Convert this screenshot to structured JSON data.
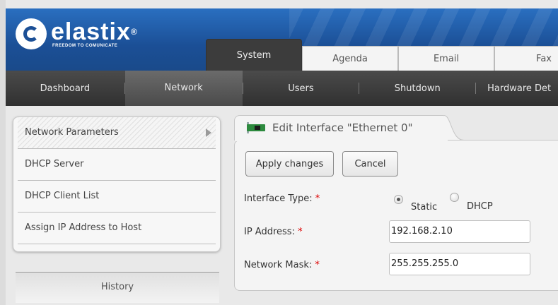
{
  "header": {
    "logo_name": "elastix",
    "logo_reg": "®",
    "logo_tagline": "FREEDOM TO COMUNICATE",
    "tabs": [
      {
        "label": "System",
        "active": true
      },
      {
        "label": "Agenda",
        "active": false
      },
      {
        "label": "Email",
        "active": false
      },
      {
        "label": "Fax",
        "active": false
      }
    ]
  },
  "menubar": {
    "items": [
      {
        "label": "Dashboard",
        "active": false
      },
      {
        "label": "Network",
        "active": true
      },
      {
        "label": "Users",
        "active": false
      },
      {
        "label": "Shutdown",
        "active": false
      },
      {
        "label": "Hardware Det",
        "active": false
      }
    ]
  },
  "sidebar": {
    "items": [
      {
        "label": "Network Parameters",
        "active": true
      },
      {
        "label": "DHCP Server",
        "active": false
      },
      {
        "label": "DHCP Client List",
        "active": false
      },
      {
        "label": "Assign IP Address to Host",
        "active": false
      }
    ],
    "history_label": "History"
  },
  "panel": {
    "title": "Edit Interface \"Ethernet 0\"",
    "apply_label": "Apply changes",
    "cancel_label": "Cancel",
    "interface_type_label": "Interface Type:",
    "required_mark": "*",
    "type_options": [
      {
        "label": "Static",
        "checked": true
      },
      {
        "label": "DHCP",
        "checked": false
      }
    ],
    "ip_label": "IP Address:",
    "ip_value": "192.168.2.10",
    "mask_label": "Network Mask:",
    "mask_value": "255.255.255.0"
  }
}
